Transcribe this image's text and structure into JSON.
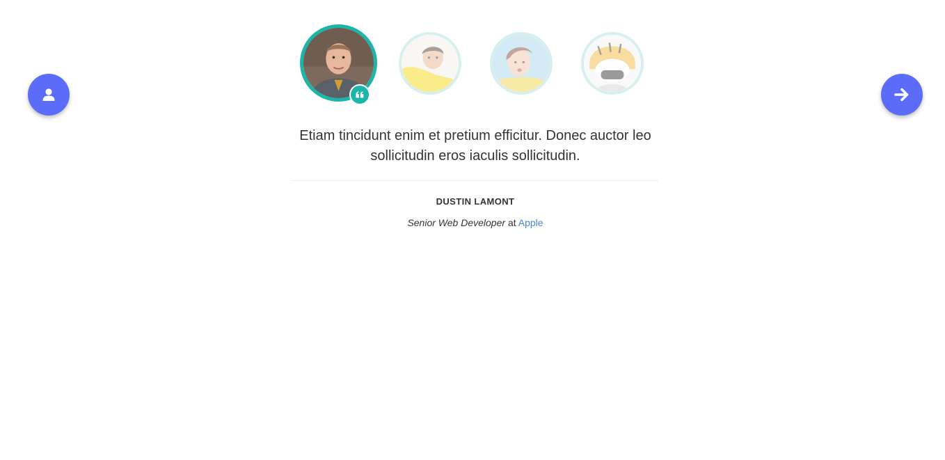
{
  "nav": {
    "left_button_icon": "user-icon",
    "right_button_icon": "arrow-right-icon",
    "accent_color": "#5b6cf9"
  },
  "testimonials": {
    "accent_color": "#1bb5a9",
    "avatars": [
      {
        "icon": "avatar-photo-man-active"
      },
      {
        "icon": "avatar-photo-young-man"
      },
      {
        "icon": "avatar-photo-woman"
      },
      {
        "icon": "avatar-photo-tiger-costume"
      }
    ],
    "badge_icon": "quote-icon",
    "quote": "Etiam tincidunt enim et pretium efficitur. Donec auctor leo sollicitudin eros iaculis sollicitudin.",
    "author_name": "DUSTIN LAMONT",
    "author_title": "Senior Web Developer",
    "author_at": "at",
    "author_company": "Apple",
    "company_link_color": "#4a84c4"
  }
}
